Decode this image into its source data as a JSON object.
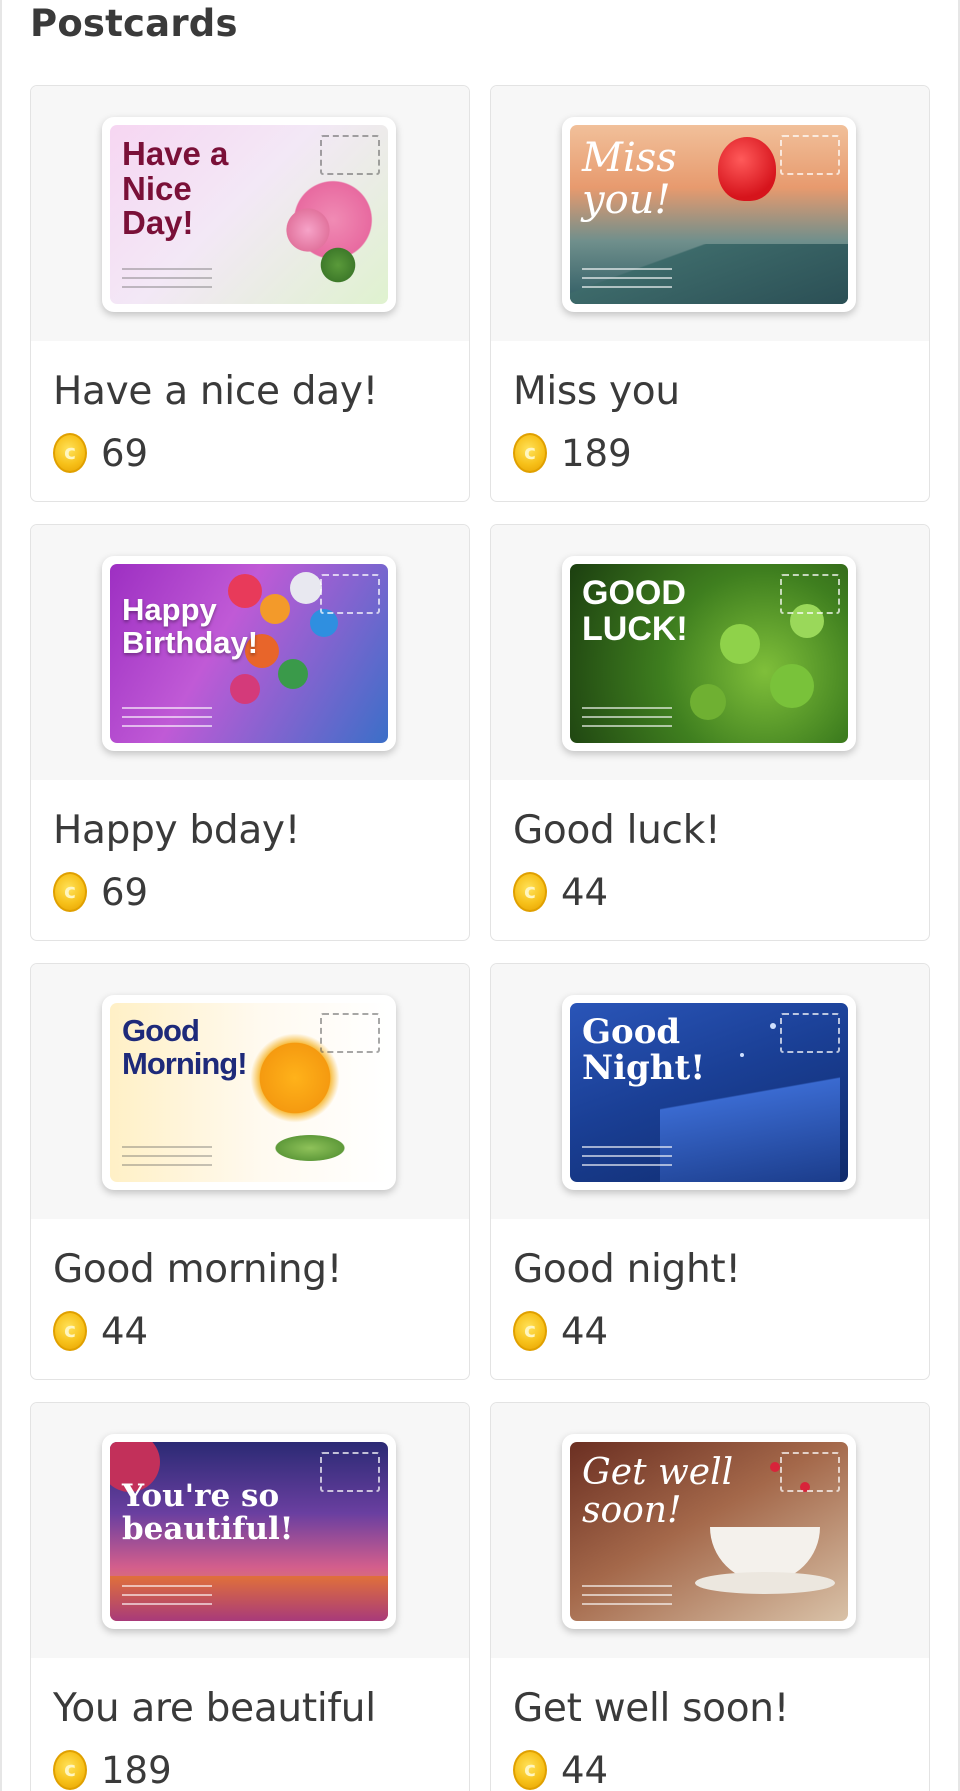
{
  "header": {
    "title": "Postcards"
  },
  "cards": [
    {
      "name": "Have a nice day!",
      "price": "69",
      "image_text": "Have a Nice Day!",
      "theme": "flowers",
      "colors": {
        "bg1": "#f7d8f0",
        "bg2": "#e8f5d0",
        "text": "#7a1038"
      }
    },
    {
      "name": "Miss you",
      "price": "189",
      "image_text": "Miss you!",
      "theme": "balloon-valley",
      "colors": {
        "bg1": "#e6a47a",
        "bg2": "#3f6b6e",
        "text": "#ffffff"
      }
    },
    {
      "name": "Happy bday!",
      "price": "69",
      "image_text": "Happy Birthday!",
      "theme": "balloons",
      "colors": {
        "bg1": "#a23cc4",
        "bg2": "#2f5fb8",
        "text": "#ffffff"
      }
    },
    {
      "name": "Good luck!",
      "price": "44",
      "image_text": "GOOD LUCK!",
      "theme": "clovers",
      "colors": {
        "bg1": "#1f4d14",
        "bg2": "#5c9a2c",
        "text": "#ffffff"
      }
    },
    {
      "name": "Good morning!",
      "price": "44",
      "image_text": "Good Morning!",
      "theme": "sun",
      "colors": {
        "bg1": "#fff4d0",
        "bg2": "#ffffff",
        "text": "#1e2a7a"
      }
    },
    {
      "name": "Good night!",
      "price": "44",
      "image_text": "Good Night!",
      "theme": "night",
      "colors": {
        "bg1": "#1c3c8c",
        "bg2": "#3d6fd1",
        "text": "#ffffff"
      }
    },
    {
      "name": "You are beautiful",
      "price": "189",
      "image_text": "You're so beautiful!",
      "theme": "meadow",
      "colors": {
        "bg1": "#3a2f7a",
        "bg2": "#d65e8e",
        "text": "#ffffff"
      }
    },
    {
      "name": "Get well soon!",
      "price": "44",
      "image_text": "Get well soon!",
      "theme": "tea",
      "colors": {
        "bg1": "#7a3a2a",
        "bg2": "#d9c2a8",
        "text": "#ffffff"
      }
    }
  ]
}
